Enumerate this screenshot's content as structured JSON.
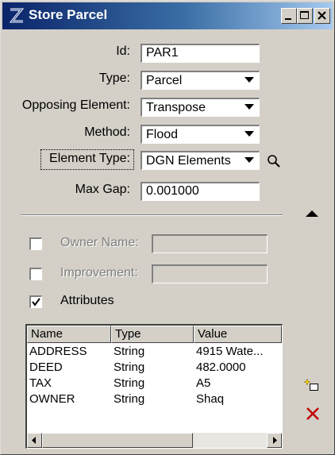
{
  "window": {
    "title": "Store Parcel"
  },
  "form": {
    "id_label": "Id:",
    "id_value": "PAR1",
    "type_label": "Type:",
    "type_value": "Parcel",
    "opposing_label": "Opposing Element:",
    "opposing_value": "Transpose",
    "method_label": "Method:",
    "method_value": "Flood",
    "element_type_label": "Element Type:",
    "element_type_value": "DGN Elements",
    "max_gap_label": "Max Gap:",
    "max_gap_value": "0.001000"
  },
  "options": {
    "owner_name_label": "Owner Name:",
    "owner_name_checked": false,
    "owner_name_value": "",
    "improvement_label": "Improvement:",
    "improvement_checked": false,
    "improvement_value": "",
    "attributes_label": "Attributes",
    "attributes_checked": true
  },
  "grid": {
    "columns": [
      "Name",
      "Type",
      "Value"
    ],
    "rows": [
      [
        "ADDRESS",
        "String",
        "4915 Wate..."
      ],
      [
        "DEED",
        "String",
        "482.0000"
      ],
      [
        "TAX",
        "String",
        "A5"
      ],
      [
        "OWNER",
        "String",
        "Shaq"
      ]
    ]
  },
  "icons": {
    "app": "microstation-icon",
    "search": "magnifier-icon",
    "add_row": "new-item-icon",
    "delete_row": "delete-x-icon"
  },
  "colors": {
    "titlebar_start": "#0a246a",
    "titlebar_end": "#a6caf0",
    "dialog": "#d4d0c8",
    "delete": "#c00000"
  }
}
